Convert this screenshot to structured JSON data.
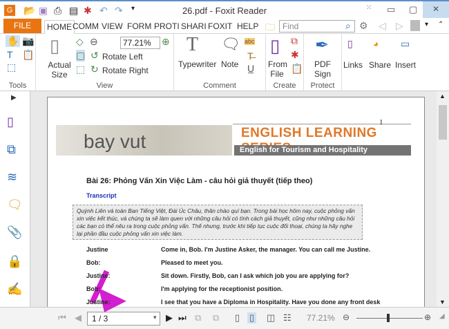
{
  "window": {
    "title": "26.pdf - Foxit Reader"
  },
  "tabs": [
    "FILE",
    "HOME",
    "COMM",
    "VIEW",
    "FORM",
    "PROTI",
    "SHARI",
    "FOXIT",
    "HELP"
  ],
  "search": {
    "placeholder": "Find"
  },
  "ribbon": {
    "tools_label": "Tools",
    "view_label": "View",
    "comment_label": "Comment",
    "create_label": "Create",
    "protect_label": "Protect",
    "actual_size": "Actual Size",
    "zoom_value": "77.21%",
    "rotate_left": "Rotate Left",
    "rotate_right": "Rotate Right",
    "typewriter": "Typewriter",
    "note": "Note",
    "from_file": "From File",
    "pdf_sign": "PDF Sign",
    "links": "Links",
    "share": "Share",
    "insert": "Insert",
    "abc": "abc"
  },
  "document": {
    "page_number": "1",
    "logo": "bay vut",
    "series": "ENGLISH LEARNING SERIES",
    "subtitle": "English for Tourism and Hospitality",
    "heading": "Bài 26: Phỏng Vấn Xin Việc Làm - câu hỏi giả thuyết (tiếp theo)",
    "transcript": "Transcript",
    "intro": "Quỳnh Liên và toàn Ban Tiếng Việt, Đài Úc Châu, thân chào quí bạn. Trong bài học hôm nay, cuộc phỏng vấn xin việc kết thúc, và chúng ta sẽ làm quen với những câu hỏi có tính cách giả thuyết, cũng như những câu hỏi các bạn có thể nêu ra trong cuộc phỏng vấn. Thế nhưng, trước khi tiếp tục cuộc đối thoại, chúng ta hãy nghe lại phần đầu cuộc phỏng vấn xin việc làm.",
    "dialogue": [
      {
        "speaker": "Justine",
        "line": "Come in, Bob. I'm Justine Asker, the manager. You can call me Justine."
      },
      {
        "speaker": "Bob:",
        "line": "Pleased to meet you."
      },
      {
        "speaker": "Justine:",
        "line": "Sit down. Firstly, Bob, can I ask which job you are applying for?"
      },
      {
        "speaker": "Bob:",
        "line": "I'm applying for the receptionist position."
      },
      {
        "speaker": "Justine:",
        "line": "I see that you have a Diploma in Hospitality. Have you done any front desk"
      }
    ]
  },
  "statusbar": {
    "page": "1 / 3",
    "zoom": "77.21%",
    "zoom_level_percent": 77.21
  },
  "colors": {
    "file_tab": "#e87511",
    "annotation_arrow": "#d21fd0",
    "series_title": "#e07828"
  }
}
